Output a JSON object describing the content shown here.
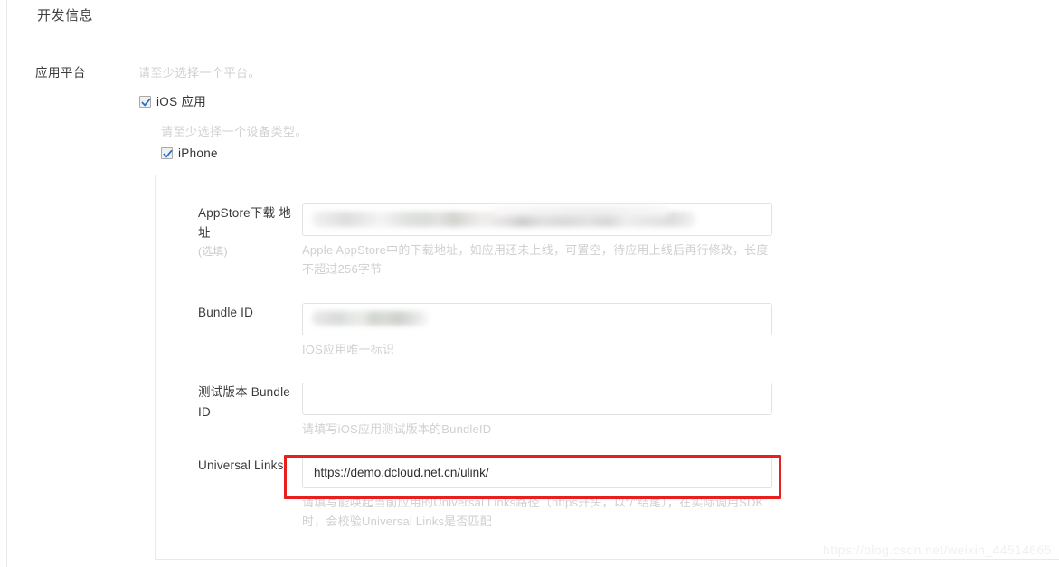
{
  "header": {
    "title": "开发信息"
  },
  "platform_row": {
    "label": "应用平台",
    "hint": "请至少选择一个平台。"
  },
  "checkboxes": {
    "ios": {
      "label": "iOS 应用",
      "checked": true,
      "icon": "checkmark-icon"
    },
    "device_hint": "请至少选择一个设备类型。",
    "iphone": {
      "label": "iPhone",
      "checked": true,
      "icon": "checkmark-icon"
    }
  },
  "fields": [
    {
      "key": "appstore_url",
      "label": "AppStore下载",
      "label_line2": "地址",
      "optional": "(选填)",
      "value": "",
      "placeholder": "",
      "redacted": true,
      "help": "Apple AppStore中的下载地址，如应用还未上线，可置空，待应用上线后再行修改，长度不超过256字节"
    },
    {
      "key": "bundle_id",
      "label": "Bundle ID",
      "label_line2": "",
      "optional": "",
      "value": "",
      "placeholder": "",
      "redacted": true,
      "help": "IOS应用唯一标识"
    },
    {
      "key": "test_bundle_id",
      "label": "测试版本",
      "label_line2": "Bundle ID",
      "optional": "",
      "value": "",
      "placeholder": "",
      "redacted": false,
      "help": "请填写iOS应用测试版本的BundleID"
    },
    {
      "key": "universal_links",
      "label": "Universal",
      "label_line2": "Links",
      "optional": "",
      "value": "https://demo.dcloud.net.cn/ulink/",
      "placeholder": "",
      "redacted": false,
      "help": "请填写能唤起当前应用的Universal Links路径（https开头，以“/”结尾），在实际调用SDK时，会校验Universal Links是否匹配"
    }
  ],
  "highlight": {
    "name": "universal-links-highlight",
    "color": "#e8201d"
  },
  "watermark": {
    "text": "https://blog.csdn.net/weixin_44514665"
  },
  "colors": {
    "accent_check": "#1a73c8",
    "highlight": "#e8201d",
    "help_text": "#d0d0d0",
    "border": "#e2e2e2"
  }
}
